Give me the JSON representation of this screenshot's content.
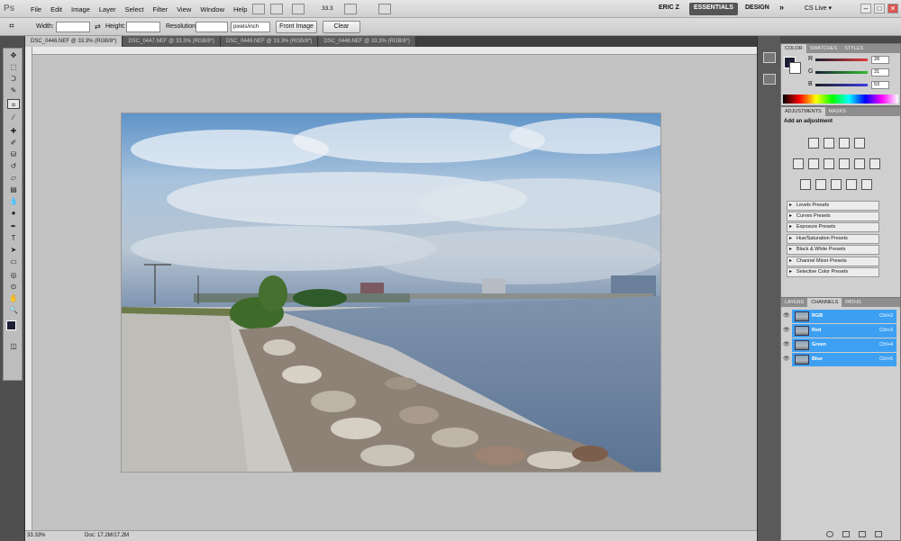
{
  "app": {
    "logo": "Ps"
  },
  "menu": [
    "File",
    "Edit",
    "Image",
    "Layer",
    "Select",
    "Filter",
    "View",
    "Window",
    "Help"
  ],
  "zoom_control": "33.3",
  "workspace": {
    "user": "ERIC Z",
    "essentials": "ESSENTIALS",
    "design": "DESIGN",
    "more": "»",
    "cslive": "CS Live ▾"
  },
  "window_controls": {
    "minimize": "–",
    "restore": "□",
    "close": "✕"
  },
  "options": {
    "width_label": "Width:",
    "height_label": "Height:",
    "resolution_label": "Resolution:",
    "units_value": "pixels/inch",
    "front_image": "Front Image",
    "clear": "Clear"
  },
  "doc_tabs": [
    "DSC_0446.NEF @ 33.3% (RGB/8*)",
    "DSC_0447.NEF @ 33.3% (RGB/8*)",
    "DSC_0449.NEF @ 33.3% (RGB/8*)",
    "DSC_0448.NEF @ 33.3% (RGB/8*)"
  ],
  "status": {
    "zoom": "33.33%",
    "doc": "Doc: 17.2M/17.2M"
  },
  "color_panel": {
    "tabs": [
      "COLOR",
      "SWATCHES",
      "STYLES"
    ],
    "channels": [
      {
        "label": "R",
        "value": "28",
        "color": "#e23b3b"
      },
      {
        "label": "G",
        "value": "31",
        "color": "#2fbf2f"
      },
      {
        "label": "B",
        "value": "53",
        "color": "#3b3be2"
      }
    ],
    "foreground": "#1c1f35"
  },
  "adjustments_panel": {
    "tabs": [
      "ADJUSTMENTS",
      "MASKS"
    ],
    "heading": "Add an adjustment",
    "presets": [
      "Levels Presets",
      "Curves Presets",
      "Exposure Presets",
      "Hue/Saturation Presets",
      "Black & White Presets",
      "Channel Mixer Presets",
      "Selective Color Presets"
    ]
  },
  "channels_panel": {
    "tabs": [
      "LAYERS",
      "CHANNELS",
      "PATHS"
    ],
    "rows": [
      {
        "name": "RGB",
        "shortcut": "Ctrl+2"
      },
      {
        "name": "Red",
        "shortcut": "Ctrl+3"
      },
      {
        "name": "Green",
        "shortcut": "Ctrl+4"
      },
      {
        "name": "Blue",
        "shortcut": "Ctrl+5"
      }
    ]
  }
}
